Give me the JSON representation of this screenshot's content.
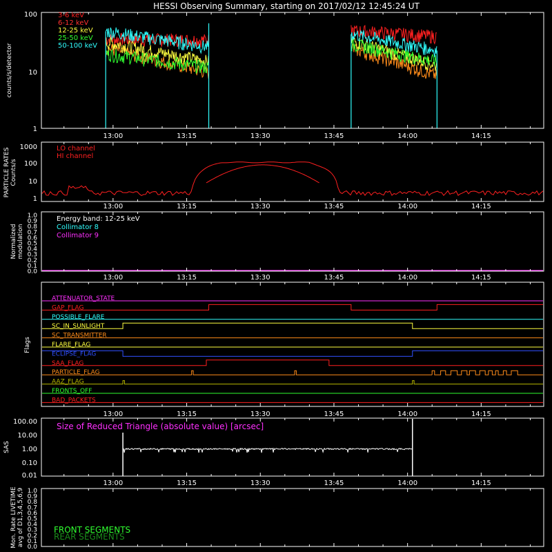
{
  "title": "HESSI Observing Summary, starting on 2017/02/12 12:45:24 UT",
  "time_ticks": [
    "13:00",
    "13:15",
    "13:30",
    "13:45",
    "14:00",
    "14:15"
  ],
  "chart_data": [
    {
      "type": "line",
      "name": "counts",
      "ylabel": "counts/s/detector",
      "yscale": "log",
      "ylim": [
        1,
        100
      ],
      "yticks": [
        "1",
        "10",
        "100"
      ],
      "series": [
        {
          "name": "3-6 keV",
          "color": "#ff2020"
        },
        {
          "name": "6-12 keV",
          "color": "#ff3030"
        },
        {
          "name": "12-25 keV",
          "color": "#ffff40"
        },
        {
          "name": "25-50 keV",
          "color": "#30ff30"
        },
        {
          "name": "50-100 keV",
          "color": "#30ffff"
        }
      ],
      "note_series_styles": [
        "#ff2020",
        "#ff8c1a",
        "#ffff40",
        "#30ff30",
        "#30ffff"
      ],
      "segments": [
        {
          "start": "12:58:30",
          "end": "13:19:30",
          "values_start": [
            34,
            24,
            30,
            19,
            47
          ],
          "values_end": [
            33,
            9,
            14,
            11,
            25
          ],
          "spike_end": 65
        },
        {
          "start": "13:48:30",
          "end": "14:06:00",
          "values_start": [
            48,
            24,
            32,
            28,
            42
          ],
          "values_end": [
            38,
            8,
            12,
            14,
            22
          ]
        }
      ]
    },
    {
      "type": "line",
      "name": "particle_rates",
      "ylabel_line1": "PARTICLE RATES",
      "ylabel_line2": "Counts/s",
      "yscale": "log",
      "ylim": [
        1,
        1000
      ],
      "yticks": [
        "1",
        "10",
        "100",
        "1000"
      ],
      "series": [
        {
          "name": "LO channel",
          "color": "#ff2020",
          "baseline": 2.5
        },
        {
          "name": "HI channel",
          "color": "#ff2020",
          "peak": 100
        }
      ]
    },
    {
      "type": "line",
      "name": "modulation",
      "ylabel_line1": "Normalized",
      "ylabel_line2": "modulation",
      "ylim": [
        0,
        1
      ],
      "yticks": [
        "0.0",
        "0.1",
        "0.2",
        "0.3",
        "0.4",
        "0.5",
        "0.6",
        "0.7",
        "0.8",
        "0.9",
        "1.0"
      ],
      "annotation": "Energy band: 12-25 keV",
      "series": [
        {
          "name": "Collimator 8",
          "color": "#30ffff"
        },
        {
          "name": "Collimator 9",
          "color": "#ff30ff"
        }
      ]
    },
    {
      "type": "line",
      "name": "flags",
      "ylabel": "Flags",
      "flags": [
        {
          "name": "ATTENUATOR_STATE",
          "color": "#ff30ff"
        },
        {
          "name": "GAP_FLAG",
          "color": "#ff2020"
        },
        {
          "name": "POSSIBLE_FLARE",
          "color": "#30ffff"
        },
        {
          "name": "SC_IN_SUNLIGHT",
          "color": "#ffff40"
        },
        {
          "name": "SC_TRANSMITTER",
          "color": "#ff8c1a"
        },
        {
          "name": "FLARE_FLAG",
          "color": "#ffff40"
        },
        {
          "name": "ECLIPSE_FLAG",
          "color": "#3050ff"
        },
        {
          "name": "SAA_FLAG",
          "color": "#ff2020"
        },
        {
          "name": "PARTICLE_FLAG",
          "color": "#ff8c1a"
        },
        {
          "name": "AAZ_FLAG",
          "color": "#b8b800"
        },
        {
          "name": "FRONTS_OFF",
          "color": "#30ff30"
        },
        {
          "name": "BAD_PACKETS",
          "color": "#ff2020"
        }
      ]
    },
    {
      "type": "line",
      "name": "sas",
      "ylabel": "SAS",
      "yscale": "log",
      "ylim": [
        0.01,
        100
      ],
      "yticks": [
        "0.01",
        "0.10",
        "1.00",
        "10.00",
        "100.00"
      ],
      "annotation": "Size of Reduced Triangle (absolute value) [arcsec]",
      "annotation_color": "#ff30ff",
      "series": [
        {
          "start": "13:02",
          "end": "14:01",
          "level": 0.75,
          "color": "#ffffff"
        }
      ]
    },
    {
      "type": "line",
      "name": "livetime",
      "ylabel_line1": "Mon. Rate LIVETIME",
      "ylabel_line2": "avg of D1,3,4,5,6,9",
      "ylim": [
        0,
        1
      ],
      "yticks": [
        "0.0",
        "0.1",
        "0.2",
        "0.3",
        "0.4",
        "0.5",
        "0.6",
        "0.7",
        "0.8",
        "0.9",
        "1.0"
      ],
      "series": [
        {
          "name": "FRONT SEGMENTS",
          "color": "#30ff30"
        },
        {
          "name": "REAR SEGMENTS",
          "color": "#1a8c1a"
        }
      ]
    }
  ]
}
